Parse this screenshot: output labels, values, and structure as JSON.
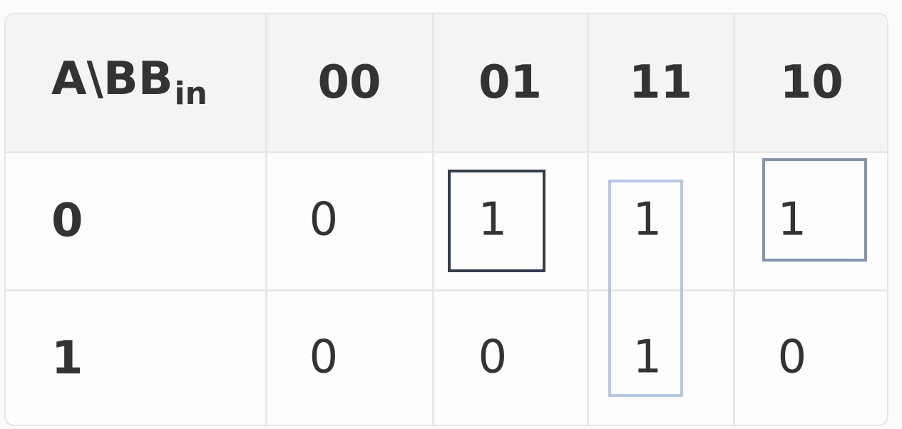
{
  "kmap": {
    "corner_label": "A\\BB",
    "corner_sub": "in",
    "columns": [
      "00",
      "01",
      "11",
      "10"
    ],
    "rows": [
      {
        "label": "0",
        "cells": [
          "0",
          "1",
          "1",
          "1"
        ]
      },
      {
        "label": "1",
        "cells": [
          "0",
          "0",
          "1",
          "0"
        ]
      }
    ]
  },
  "groups": [
    {
      "name": "group-row0-col01",
      "color": "#333d4c"
    },
    {
      "name": "group-col11-both-rows",
      "color": "#b5c7e4"
    },
    {
      "name": "group-row0-col10",
      "color": "#8393ab"
    }
  ]
}
